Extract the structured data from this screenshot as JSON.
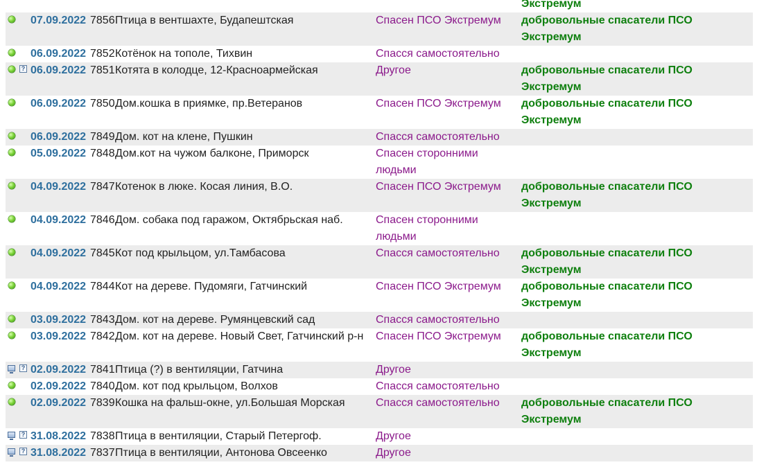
{
  "rows": [
    {
      "shaded": false,
      "icons": [],
      "date": "",
      "num": "",
      "title": "",
      "status": "",
      "org": "Экстремум"
    },
    {
      "shaded": true,
      "icons": [
        "ball"
      ],
      "date": "07.09.2022",
      "num": "7856",
      "title": "Птица в вентшахте, Будапештская",
      "status": "Спасен ПСО Экстремум",
      "org": "добровольные спасатели ПСО Экстремум"
    },
    {
      "shaded": false,
      "icons": [
        "ball"
      ],
      "date": "06.09.2022",
      "num": "7852",
      "title": "Котёнок на тополе, Тихвин",
      "status": "Спасся самостоятельно",
      "org": ""
    },
    {
      "shaded": true,
      "icons": [
        "ball",
        "question-doc"
      ],
      "date": "06.09.2022",
      "num": "7851",
      "title": "Котята в колодце, 12-Красноармейская",
      "status": "Другое",
      "org": "добровольные спасатели ПСО Экстремум"
    },
    {
      "shaded": false,
      "icons": [
        "ball"
      ],
      "date": "06.09.2022",
      "num": "7850",
      "title": "Дом.кошка в приямке, пр.Ветеранов",
      "status": "Спасен ПСО Экстремум",
      "org": "добровольные спасатели ПСО Экстремум"
    },
    {
      "shaded": true,
      "icons": [
        "ball"
      ],
      "date": "06.09.2022",
      "num": "7849",
      "title": "Дом. кот на клене, Пушкин",
      "status": "Спасся самостоятельно",
      "org": ""
    },
    {
      "shaded": false,
      "icons": [
        "ball"
      ],
      "date": "05.09.2022",
      "num": "7848",
      "title": "Дом.кот на чужом балконе, Приморск",
      "status": "Спасен сторонними людьми",
      "org": ""
    },
    {
      "shaded": true,
      "icons": [
        "ball"
      ],
      "date": "04.09.2022",
      "num": "7847",
      "title": "Котенок в люке. Косая линия, В.О.",
      "status": "Спасен ПСО Экстремум",
      "org": "добровольные спасатели ПСО Экстремум"
    },
    {
      "shaded": false,
      "icons": [
        "ball"
      ],
      "date": "04.09.2022",
      "num": "7846",
      "title": "Дом. собака под гаражом, Октябрьская наб.",
      "status": "Спасен сторонними людьми",
      "org": ""
    },
    {
      "shaded": true,
      "icons": [
        "ball"
      ],
      "date": "04.09.2022",
      "num": "7845",
      "title": "Кот под крыльцом, ул.Тамбасова",
      "status": "Спасся самостоятельно",
      "org": "добровольные спасатели ПСО Экстремум"
    },
    {
      "shaded": false,
      "icons": [
        "ball"
      ],
      "date": "04.09.2022",
      "num": "7844",
      "title": "Кот на дереве. Пудомяги, Гатчинский",
      "status": "Спасен ПСО Экстремум",
      "org": "добровольные спасатели ПСО Экстремум"
    },
    {
      "shaded": true,
      "icons": [
        "ball"
      ],
      "date": "03.09.2022",
      "num": "7843",
      "title": "Дом. кот на дереве. Румянцевский сад",
      "status": "Спасся самостоятельно",
      "org": ""
    },
    {
      "shaded": false,
      "icons": [
        "ball"
      ],
      "date": "03.09.2022",
      "num": "7842",
      "title": "Дом. кот на дереве. Новый Свет, Гатчинский р-н",
      "status": "Спасен ПСО Экстремум",
      "org": "добровольные спасатели ПСО Экстремум"
    },
    {
      "shaded": true,
      "icons": [
        "monitor",
        "question-doc"
      ],
      "date": "02.09.2022",
      "num": "7841",
      "title": "Птица (?) в вентиляции, Гатчина",
      "status": "Другое",
      "org": ""
    },
    {
      "shaded": false,
      "icons": [
        "ball"
      ],
      "date": "02.09.2022",
      "num": "7840",
      "title": "Дом. кот под крыльцом, Волхов",
      "status": "Спасся самостоятельно",
      "org": ""
    },
    {
      "shaded": true,
      "icons": [
        "ball"
      ],
      "date": "02.09.2022",
      "num": "7839",
      "title": "Кошка на фальш-окне, ул.Большая Морская",
      "status": "Спасся самостоятельно",
      "org": "добровольные спасатели ПСО Экстремум"
    },
    {
      "shaded": false,
      "icons": [
        "monitor",
        "question-doc"
      ],
      "date": "31.08.2022",
      "num": "7838",
      "title": "Птица в вентиляции, Старый Петергоф.",
      "status": "Другое",
      "org": ""
    },
    {
      "shaded": true,
      "icons": [
        "monitor",
        "question-doc"
      ],
      "date": "31.08.2022",
      "num": "7837",
      "title": "Птица в вентиляции, Антонова Овсеенко",
      "status": "Другое",
      "org": ""
    }
  ],
  "icon_glyphs": {
    "question-doc": "?"
  },
  "colors": {
    "date": "#2e6f9e",
    "status": "#8b1a8b",
    "org": "#0e7f0e",
    "row_shade": "#ececec"
  }
}
